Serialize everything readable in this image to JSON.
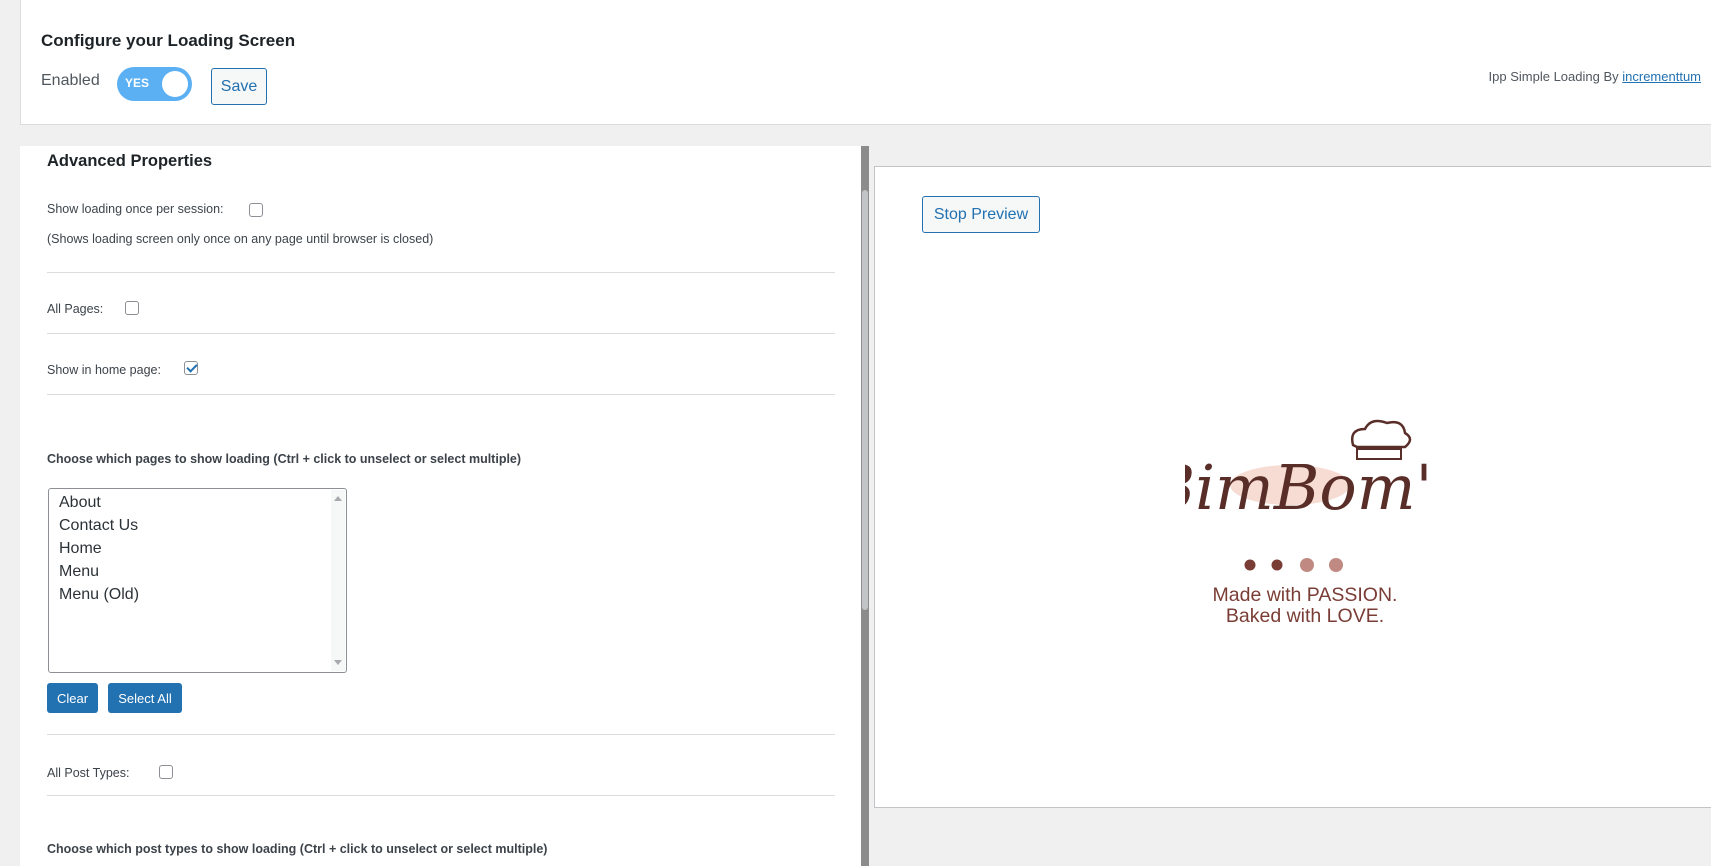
{
  "header": {
    "title": "Configure your Loading Screen",
    "enabled_label": "Enabled",
    "toggle_label": "YES",
    "toggle_on": true,
    "save_label": "Save",
    "credit_text": "Ipp Simple Loading By",
    "credit_link": "incrementtum"
  },
  "advanced": {
    "title": "Advanced Properties",
    "once_per_session_label": "Show loading once per session:",
    "once_per_session_checked": false,
    "once_per_session_hint": "(Shows loading screen only once on any page until browser is closed)",
    "all_pages_label": "All Pages:",
    "all_pages_checked": false,
    "home_page_label": "Show in home page:",
    "home_page_checked": true,
    "pages_heading": "Choose which pages to show loading (Ctrl + click to unselect or select multiple)",
    "pages": [
      "About",
      "Contact Us",
      "Home",
      "Menu",
      "Menu (Old)"
    ],
    "clear_label": "Clear",
    "select_all_label": "Select All",
    "all_post_types_label": "All Post Types:",
    "all_post_types_checked": false,
    "post_types_heading": "Choose which post types to show loading (Ctrl + click to unselect or select multiple)"
  },
  "preview": {
    "stop_label": "Stop Preview",
    "logo_text": "BimBom's",
    "tagline_line1": "Made with PASSION.",
    "tagline_line2": "Baked with LOVE.",
    "dot_colors": [
      "#7a3d35",
      "#7a3d35",
      "#c08a82",
      "#c08a82"
    ]
  },
  "colors": {
    "accent": "#2271b1",
    "toggle": "#5bb0f4",
    "brand": "#7a3d35"
  }
}
